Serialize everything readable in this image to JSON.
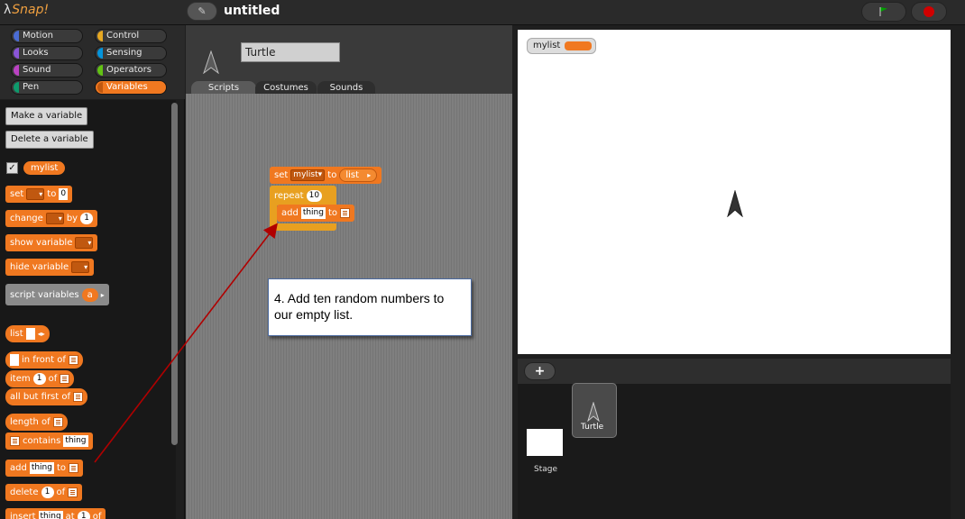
{
  "app": {
    "logo_lambda": "λ",
    "logo_text": "Snap!",
    "project_title": "untitled"
  },
  "colors": {
    "variables": "#f07820",
    "control": "#e8a020",
    "stop": "#d10000",
    "flag": "#00a000"
  },
  "categories": [
    {
      "label": "Motion",
      "color": "#4a6cd4"
    },
    {
      "label": "Control",
      "color": "#e6a822"
    },
    {
      "label": "Looks",
      "color": "#8a55d7"
    },
    {
      "label": "Sensing",
      "color": "#0494dc"
    },
    {
      "label": "Sound",
      "color": "#bb42c3"
    },
    {
      "label": "Operators",
      "color": "#62c213"
    },
    {
      "label": "Pen",
      "color": "#0e9a6c"
    },
    {
      "label": "Variables",
      "color": "#f07820"
    }
  ],
  "palette": {
    "make_variable": "Make a variable",
    "delete_variable": "Delete a variable",
    "checkbox": "✓",
    "var_name": "mylist",
    "set": {
      "kw": "set",
      "kw2": "to",
      "val": "0"
    },
    "change": {
      "kw": "change",
      "kw2": "by",
      "val": "1"
    },
    "show_variable": "show variable",
    "hide_variable": "hide variable",
    "script_variables": {
      "kw": "script variables",
      "val": "a"
    },
    "list": "list",
    "in_front_of": "in front of",
    "item": {
      "kw": "item",
      "val": "1",
      "kw2": "of"
    },
    "all_but_first": "all but first of",
    "length_of": "length of",
    "contains": {
      "kw": "contains",
      "val": "thing"
    },
    "add": {
      "kw": "add",
      "val": "thing",
      "kw2": "to"
    },
    "delete": {
      "kw": "delete",
      "val": "1",
      "kw2": "of"
    },
    "insert": {
      "kw": "insert",
      "val": "thing",
      "kw2": "at",
      "val2": "1",
      "kw3": "of"
    }
  },
  "sprite": {
    "name": "Turtle",
    "tabs": [
      "Scripts",
      "Costumes",
      "Sounds"
    ]
  },
  "script": {
    "set_kw": "set",
    "set_var": "mylist",
    "set_to": "to",
    "set_list": "list",
    "repeat_kw": "repeat",
    "repeat_val": "10",
    "add_kw": "add",
    "add_val": "thing",
    "add_to": "to"
  },
  "callout": {
    "text": "4. Add ten random numbers to our empty list."
  },
  "stage": {
    "watcher_label": "mylist"
  },
  "corral": {
    "plus": "+",
    "stage_label": "Stage",
    "sprite_label": "Turtle"
  }
}
